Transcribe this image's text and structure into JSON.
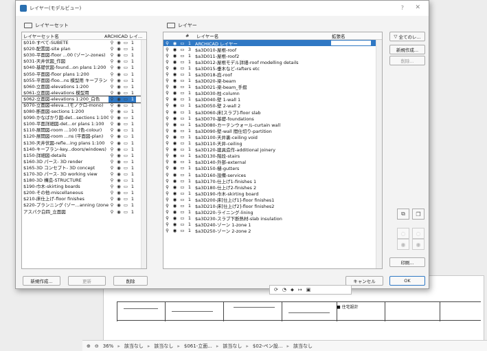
{
  "dialog": {
    "title": "レイヤー(モデルビュー)"
  },
  "left_panel": {
    "header": "レイヤーセット",
    "col_name": "レイヤーセット名",
    "col_source": "ARCHICAD レイ...",
    "rows": [
      {
        "name": "$010-すべて-SUBETE",
        "n": "1"
      },
      {
        "name": "$020-配置図-site plan",
        "n": "1"
      },
      {
        "name": "$030-平面図-floor ...00 (ゾーン-zones)",
        "n": "1"
      },
      {
        "name": "$031-天井伏図_作図",
        "n": "1"
      },
      {
        "name": "$040-基礎伏図-found...on plans 1:200",
        "n": "1"
      },
      {
        "name": "$050-平面図-floor plans 1:200",
        "n": "1"
      },
      {
        "name": "$055-平面図-floo...ns 模型用 キープラン",
        "n": "1"
      },
      {
        "name": "$060-立面図-elevations 1:200",
        "n": "1"
      },
      {
        "name": "$061-立面図-elevations 模型用",
        "n": "1"
      },
      {
        "name": "$062-立面図-elevations 1:200_白色",
        "n": "1"
      },
      {
        "name": "$070-立面図-eleva...(モノクロ-mono)",
        "n": "1"
      },
      {
        "name": "$080-断面図-sections 1:200",
        "n": "1"
      },
      {
        "name": "$090-かなばかり図-det...sections 1:100",
        "n": "1"
      },
      {
        "name": "$100-平面詳細図-det...or plans 1:100",
        "n": "1"
      },
      {
        "name": "$110-展開図-room ...100 (色-colour)",
        "n": "1"
      },
      {
        "name": "$120-展開図-room ...ns (平面図-plan)",
        "n": "1"
      },
      {
        "name": "$130-天井伏図-refle...ing plans 1:100",
        "n": "1"
      },
      {
        "name": "$140-キープラン-key...doors/windows)",
        "n": "1"
      },
      {
        "name": "$150-詳細図-details",
        "n": "1"
      },
      {
        "name": "$160-3D パース- 3D render",
        "n": "1"
      },
      {
        "name": "$165-3D コンセプト- 3D concept",
        "n": "1"
      },
      {
        "name": "$170-3D パース- 3D working view",
        "n": "1"
      },
      {
        "name": "$180-3D 構造-STRUCTURE",
        "n": "1"
      },
      {
        "name": "$190-巾木-skirting boards",
        "n": "1"
      },
      {
        "name": "$200-その他-miscellaneous",
        "n": "1"
      },
      {
        "name": "$210-床仕上げ-floor finishes",
        "n": "1"
      },
      {
        "name": "$220-プランニング (ゾー...anning (zones)",
        "n": "1"
      },
      {
        "name": "アスパク白四_立面図",
        "n": "1"
      }
    ],
    "selected_index": 9,
    "btn_new": "新規作成...",
    "btn_update": "更新",
    "btn_delete": "削除"
  },
  "right_panel": {
    "header": "レイヤー",
    "col_name": "レイヤー名",
    "col_ext": "拡張名",
    "rows": [
      {
        "n": "1",
        "name": "ARCHICAD レイヤー"
      },
      {
        "n": "3",
        "name": "$a3D010-屋根-roof"
      },
      {
        "n": "1",
        "name": "$a3D011-屋根-roof2"
      },
      {
        "n": "1",
        "name": "$a3D012-屋根モデル詳細-roof modelling details"
      },
      {
        "n": "1",
        "name": "$a3D015-垂木など-rafters etc"
      },
      {
        "n": "1",
        "name": "$a3D018-庇-roof"
      },
      {
        "n": "1",
        "name": "$a3D020-梁-beam"
      },
      {
        "n": "1",
        "name": "$a3D021-梁-beam_手摺"
      },
      {
        "n": "1",
        "name": "$a3D030-柱-column"
      },
      {
        "n": "1",
        "name": "$a3D040-壁 1-wall 1"
      },
      {
        "n": "1",
        "name": "$a3D050-壁 2-wall 2"
      },
      {
        "n": "1",
        "name": "$a3D060-床[スラブ]-floor slab"
      },
      {
        "n": "1",
        "name": "$a3D070-基礎-foundations"
      },
      {
        "n": "1",
        "name": "$a3D080-カーテンウォール-curtain wall"
      },
      {
        "n": "1",
        "name": "$a3D090-壁-wall 間仕切り-partition"
      },
      {
        "n": "1",
        "name": "$a3D100-天井裏-ceiling void"
      },
      {
        "n": "1",
        "name": "$a3D110-天井-ceiling"
      },
      {
        "n": "1",
        "name": "$a3D120-建具造作-additional joinery"
      },
      {
        "n": "1",
        "name": "$a3D130-階段-stairs"
      },
      {
        "n": "1",
        "name": "$a3D140-外部-external"
      },
      {
        "n": "1",
        "name": "$a3D150-樋-gutters"
      },
      {
        "n": "1",
        "name": "$a3D160-設備-services"
      },
      {
        "n": "1",
        "name": "$a3D170-仕上げ1-finishes 1"
      },
      {
        "n": "1",
        "name": "$a3D180-仕上げ2-finishes 2"
      },
      {
        "n": "1",
        "name": "$a3D190-巾木-skirting board"
      },
      {
        "n": "1",
        "name": "$a3D200-床[仕上げ1]-floor finishes1"
      },
      {
        "n": "1",
        "name": "$a3D210-床[仕上げ2]-floor finishes2"
      },
      {
        "n": "1",
        "name": "$a3D220-ライニング-lining"
      },
      {
        "n": "1",
        "name": "$a3D230-スラブ下断熱材-slab insulation"
      },
      {
        "n": "1",
        "name": "$a3D240-ゾーン 1-zone 1"
      },
      {
        "n": "1",
        "name": "$a3D250-ゾーン 2-zone 2"
      }
    ],
    "filter_label": "全てのレ...",
    "btn_new": "新規作成...",
    "btn_delete": "削除...",
    "btn_print": "印刷...",
    "btn_cancel": "キャンセル",
    "btn_ok": "OK"
  },
  "statusbar": {
    "zoom": "36%",
    "item1": "該当なし",
    "item2": "該当なし",
    "item3": "$061-立面...",
    "item4": "該当なし",
    "item5": "$02-ペン設...",
    "item6": "該当なし"
  },
  "titleblock": {
    "company": "■ 住宅設計"
  }
}
